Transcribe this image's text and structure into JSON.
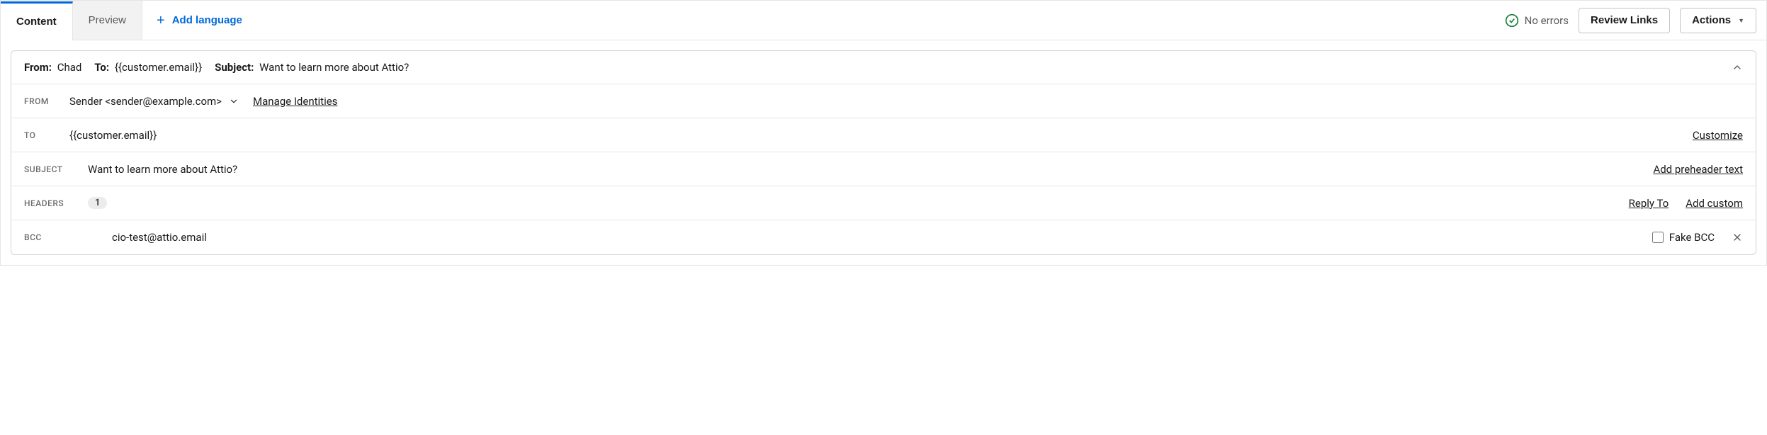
{
  "tabs": {
    "content": "Content",
    "preview": "Preview",
    "add_language": "Add language"
  },
  "topbar": {
    "status": "No errors",
    "review_links": "Review Links",
    "actions": "Actions"
  },
  "summary": {
    "from_label": "From:",
    "from_value": "Chad",
    "to_label": "To:",
    "to_value": "{{customer.email}}",
    "subject_label": "Subject:",
    "subject_value": "Want to learn more about Attio?"
  },
  "fields": {
    "from": {
      "label": "FROM",
      "value": "Sender <sender@example.com>",
      "manage": "Manage Identities"
    },
    "to": {
      "label": "TO",
      "value": "{{customer.email}}",
      "customize": "Customize"
    },
    "subject": {
      "label": "SUBJECT",
      "value": "Want to learn more about Attio?",
      "preheader": "Add preheader text"
    },
    "headers": {
      "label": "HEADERS",
      "count": "1",
      "reply_to": "Reply To",
      "add_custom": "Add custom"
    },
    "bcc": {
      "label": "BCC",
      "value": "cio-test@attio.email",
      "fake_bcc": "Fake BCC"
    }
  }
}
